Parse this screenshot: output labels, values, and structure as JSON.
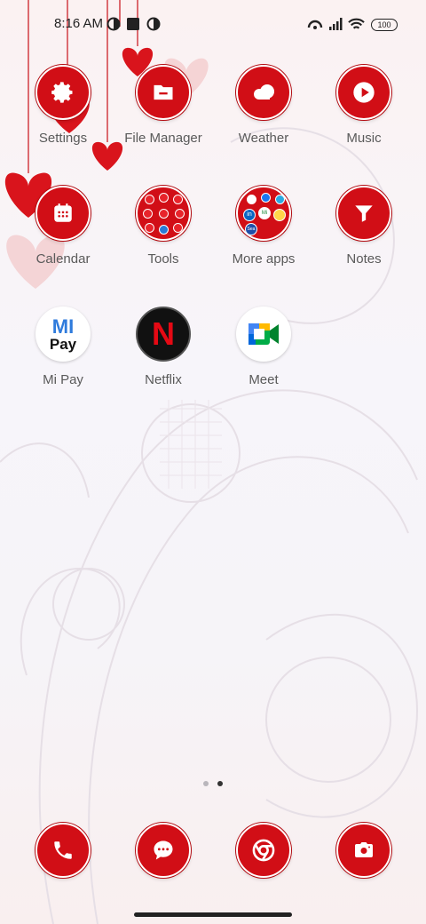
{
  "status_bar": {
    "time": "8:16 AM",
    "battery": "100",
    "icons": [
      "data-saver-icon",
      "stop-square-icon",
      "data-saver-icon",
      "hotspot-icon",
      "signal-icon",
      "wifi-icon"
    ]
  },
  "apps": [
    {
      "label": "Settings",
      "icon": "gear-icon"
    },
    {
      "label": "File Manager",
      "icon": "folder-icon"
    },
    {
      "label": "Weather",
      "icon": "cloud-icon"
    },
    {
      "label": "Music",
      "icon": "play-icon"
    },
    {
      "label": "Calendar",
      "icon": "calendar-icon"
    },
    {
      "label": "Tools",
      "icon": "folder-icon"
    },
    {
      "label": "More apps",
      "icon": "folder-icon"
    },
    {
      "label": "Notes",
      "icon": "notes-icon"
    },
    {
      "label": "Mi Pay",
      "icon": "mi-pay-logo",
      "logo_text": [
        "MI",
        "Pay"
      ]
    },
    {
      "label": "Netflix",
      "icon": "netflix-logo",
      "logo_text": "N"
    },
    {
      "label": "Meet",
      "icon": "meet-logo"
    }
  ],
  "more_apps_folder": {
    "mini_labels": [
      "in",
      "Mi",
      "Sea"
    ]
  },
  "page_indicator": {
    "pages": 2,
    "current": 2
  },
  "dock": [
    {
      "name": "phone",
      "icon": "phone-icon"
    },
    {
      "name": "messages",
      "icon": "chat-icon"
    },
    {
      "name": "chrome",
      "icon": "chrome-icon"
    },
    {
      "name": "camera",
      "icon": "camera-icon"
    }
  ],
  "colors": {
    "accent": "#d10e16",
    "label": "#5a5a5a",
    "background": "#f7f5fa"
  }
}
